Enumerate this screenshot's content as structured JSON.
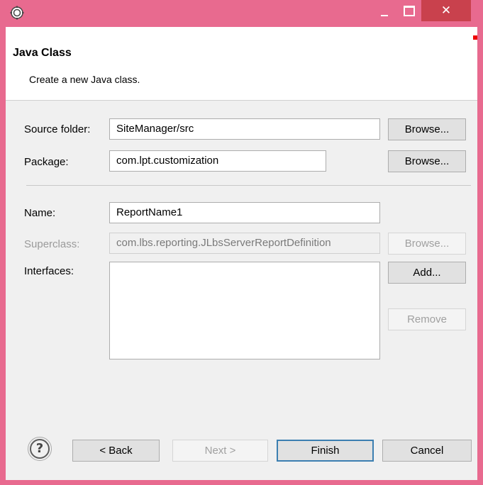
{
  "window": {
    "icon": "eclipse-gear-icon",
    "close_glyph": "✕"
  },
  "header": {
    "title": "Java Class",
    "description": "Create a new Java class."
  },
  "form": {
    "source_folder": {
      "label": "Source folder:",
      "value": "SiteManager/src",
      "browse_label": "Browse..."
    },
    "package": {
      "label": "Package:",
      "value": "com.lpt.customization",
      "browse_label": "Browse..."
    },
    "name": {
      "label": "Name:",
      "value": "ReportName1"
    },
    "superclass": {
      "label": "Superclass:",
      "value": "com.lbs.reporting.JLbsServerReportDefinition",
      "browse_label": "Browse...",
      "enabled": false
    },
    "interfaces": {
      "label": "Interfaces:",
      "items": [],
      "add_label": "Add...",
      "remove_label": "Remove"
    }
  },
  "footer": {
    "help_glyph": "?",
    "back_label": "< Back",
    "next_label": "Next >",
    "finish_label": "Finish",
    "cancel_label": "Cancel"
  },
  "colors": {
    "titlebar": "#e86a8f",
    "close_button": "#c9414d",
    "dialog_bg": "#f0f0f0"
  }
}
